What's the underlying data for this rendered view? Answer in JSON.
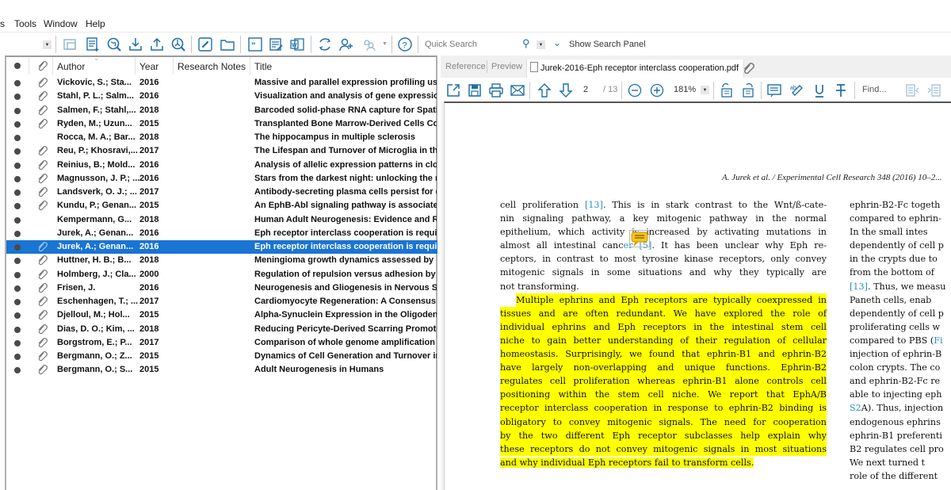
{
  "menu": {
    "items": [
      "s",
      "Tools",
      "Window",
      "Help"
    ]
  },
  "toolbar": {
    "quick_search_placeholder": "Quick Search",
    "show_search_panel": "Show Search Panel",
    "icons": [
      "new-group-icon",
      "new-reference-icon",
      "online-search-icon",
      "import-icon",
      "export-icon",
      "find-full-text-icon",
      "open-link-icon",
      "open-file-icon",
      "insert-citation-icon",
      "format-bibliography-icon",
      "word-icon",
      "sync-icon",
      "share-icon",
      "notifications-icon",
      "help-icon"
    ]
  },
  "list": {
    "columns": [
      "Author",
      "Year",
      "Research Notes",
      "Title"
    ],
    "rows": [
      {
        "attachment": true,
        "author": "Vickovic, S.; Sta...",
        "year": "2016",
        "title": "Massive and parallel expression profiling using",
        "selected": false
      },
      {
        "attachment": true,
        "author": "Stahl, P. L.; Salm...",
        "year": "2016",
        "title": "Visualization and analysis of gene expression in",
        "selected": false
      },
      {
        "attachment": true,
        "author": "Salmen, F.; Stahl,...",
        "year": "2018",
        "title": "Barcoded solid-phase RNA capture for Spatial",
        "selected": false
      },
      {
        "attachment": true,
        "author": "Ryden, M.; Uzun...",
        "year": "2015",
        "title": "Transplanted Bone Marrow-Derived Cells Con",
        "selected": false
      },
      {
        "attachment": false,
        "author": "Rocca, M. A.; Bar...",
        "year": "2018",
        "title": "The hippocampus in multiple sclerosis",
        "selected": false
      },
      {
        "attachment": true,
        "author": "Reu, P.; Khosravi,...",
        "year": "2017",
        "title": "The Lifespan and Turnover of Microglia in the",
        "selected": false
      },
      {
        "attachment": true,
        "author": "Reinius, B.; Mold...",
        "year": "2016",
        "title": "Analysis of allelic expression patterns in clonal",
        "selected": false
      },
      {
        "attachment": true,
        "author": "Magnusson, J. P.; ...",
        "year": "2016",
        "title": "Stars from the darkest night: unlocking the ne",
        "selected": false
      },
      {
        "attachment": true,
        "author": "Landsverk, O. J.; ...",
        "year": "2017",
        "title": "Antibody-secreting plasma cells persist for de",
        "selected": false
      },
      {
        "attachment": true,
        "author": "Kundu, P.; Genan...",
        "year": "2015",
        "title": "An EphB-Abl signaling pathway is associated w",
        "selected": false
      },
      {
        "attachment": false,
        "author": "Kempermann, G...",
        "year": "2018",
        "title": "Human Adult Neurogenesis: Evidence and Rer",
        "selected": false
      },
      {
        "attachment": false,
        "author": "Jurek, A.; Genan...",
        "year": "2016",
        "title": "Eph receptor interclass cooperation is require",
        "selected": false
      },
      {
        "attachment": true,
        "author": "Jurek, A.; Genan...",
        "year": "2016",
        "title": "Eph receptor interclass cooperation is require",
        "selected": true
      },
      {
        "attachment": true,
        "author": "Huttner, H. B.; B...",
        "year": "2018",
        "title": "Meningioma growth dynamics assessed by rad",
        "selected": false
      },
      {
        "attachment": true,
        "author": "Holmberg, J.; Cla...",
        "year": "2000",
        "title": "Regulation of repulsion versus adhesion by dif",
        "selected": false
      },
      {
        "attachment": true,
        "author": "Frisen, J.",
        "year": "2016",
        "title": "Neurogenesis and Gliogenesis in Nervous Syst",
        "selected": false
      },
      {
        "attachment": true,
        "author": "Eschenhagen, T.; ...",
        "year": "2017",
        "title": "Cardiomyocyte Regeneration: A Consensus Sta",
        "selected": false
      },
      {
        "attachment": true,
        "author": "Djelloul, M.; Hol...",
        "year": "2015",
        "title": "Alpha-Synuclein Expression in the Oligodendro",
        "selected": false
      },
      {
        "attachment": true,
        "author": "Dias, D. O.; Kim, ...",
        "year": "2018",
        "title": "Reducing Pericyte-Derived Scarring Promote",
        "selected": false
      },
      {
        "attachment": true,
        "author": "Borgstrom, E.; P...",
        "year": "2017",
        "title": "Comparison of whole genome amplification te",
        "selected": false
      },
      {
        "attachment": true,
        "author": "Bergmann, O.; Z...",
        "year": "2015",
        "title": "Dynamics of Cell Generation and Turnover in t",
        "selected": false
      },
      {
        "attachment": true,
        "author": "Bergmann, O.; S...",
        "year": "2015",
        "title": "Adult Neurogenesis in Humans",
        "selected": false
      }
    ]
  },
  "viewer": {
    "tabs": {
      "reference": "Reference",
      "preview": "Preview",
      "pdf": "Jurek-2016-Eph receptor interclass cooperation.pdf"
    },
    "page_current": "2",
    "page_total": "/ 13",
    "zoom": "181%",
    "find_placeholder": "Find...",
    "running_head": "A. Jurek et al. / Experimental Cell Research 348 (2016) 10–2...",
    "col1_lines": [
      [
        {
          "t": "cell proliferation "
        },
        {
          "t": "[13]",
          "ref": true
        },
        {
          "t": ". This is in stark contrast to the Wnt/ß-cate-"
        }
      ],
      [
        {
          "t": "nin signaling pathway, a key mitogenic pathway in the normal"
        }
      ],
      [
        {
          "t": "epithelium, which activity is increased by activating mutations in"
        }
      ],
      [
        {
          "t": "almost all intestinal canc"
        },
        {
          "t": "er [5]",
          "ref": true
        },
        {
          "t": ". It has been unclear why Eph re-"
        }
      ],
      [
        {
          "t": "ceptors, in contrast to most tyrosine kinase receptors, only convey"
        }
      ],
      [
        {
          "t": "mitogenic signals in some situations and why they typically are"
        }
      ],
      [
        {
          "t": "not transforming."
        }
      ]
    ],
    "highlighted_lines": [
      "Multiple ephrins and Eph receptors are typically coexpressed in",
      "tissues and are often redundant. We have explored the role of",
      "individual ephrins and Eph receptors in the intestinal stem cell",
      "niche to gain better understanding of their regulation of cellular",
      "homeostasis. Surprisingly, we found that ephrin-B1 and ephrin-B2",
      "have largely non-overlapping and unique functions. Ephrin-B2",
      "regulates cell proliferation whereas ephrin-B1 alone controls cell",
      "positioning within the stem cell niche. We report that EphA/B",
      "receptor interclass cooperation in response to ephrin-B2 binding is",
      "obligatory to convey mitogenic signals. The need for cooperation",
      "by the two different Eph receptor subclasses help explain why",
      "these receptors do not convey mitogenic signals in most situations",
      "and why individual Eph receptors fail to transform cells."
    ],
    "col2_lines": [
      [
        {
          "t": "ephrin-B2-Fc togeth"
        }
      ],
      [
        {
          "t": "compared to ephrin-"
        }
      ],
      [
        {
          "t": "    In the small intes"
        }
      ],
      [
        {
          "t": "dependently of cell p"
        }
      ],
      [
        {
          "t": "in the crypts due to"
        }
      ],
      [
        {
          "t": "from the bottom of"
        }
      ],
      [
        {
          "t": "[13]",
          "ref": true
        },
        {
          "t": ". Thus, we measu"
        }
      ],
      [
        {
          "t": "Paneth  cells,  enab"
        }
      ],
      [
        {
          "t": "dependently of cell p"
        }
      ],
      [
        {
          "t": "proliferating cells w"
        }
      ],
      [
        {
          "t": "compared to PBS ("
        },
        {
          "t": "Fi",
          "ref": true
        }
      ],
      [
        {
          "t": "injection of ephrin-B"
        }
      ],
      [
        {
          "t": "colon crypts. The co"
        }
      ],
      [
        {
          "t": "and ephrin-B2-Fc re"
        }
      ],
      [
        {
          "t": "able to injecting eph"
        }
      ],
      [
        {
          "t": "S2",
          "ref": true
        },
        {
          "t": "A). Thus, injection"
        }
      ],
      [
        {
          "t": "endogenous ephrins"
        }
      ],
      [
        {
          "t": "ephrin-B1 preferenti"
        }
      ],
      [
        {
          "t": "B2 regulates cell pro"
        }
      ],
      [
        {
          "t": "    We next turned t"
        }
      ],
      [
        {
          "t": "role of the different"
        }
      ]
    ]
  },
  "colors": {
    "accent": "#1a74d2",
    "icon": "#1f6fa8",
    "highlight": "#ffff00",
    "ref_link": "#2a8fc6"
  }
}
